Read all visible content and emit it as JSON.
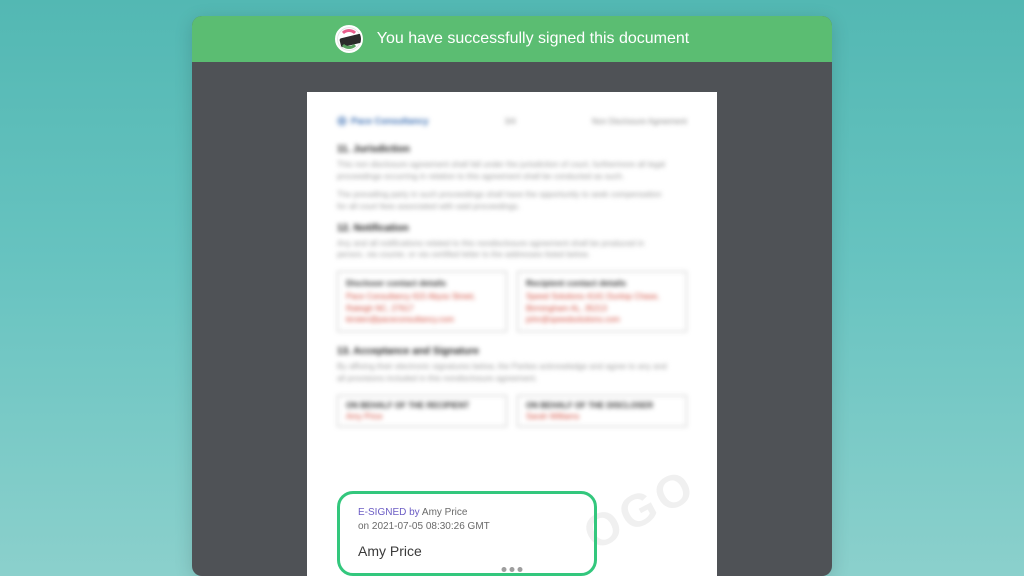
{
  "banner": {
    "message": "You have successfully signed this document"
  },
  "document": {
    "logo_label": "Pace Consultancy",
    "header_center": "3/4",
    "header_right": "Non Disclosure Agreement",
    "sections": {
      "jurisdiction": {
        "title": "11. Jurisdiction",
        "p1": "This non disclosure agreement shall fall under the jurisdiction of court, furthermore all legal proceedings occurring in relation to this agreement shall be conducted as such.",
        "p2": "The prevailing party in such proceedings shall have the opportunity to seek compensation for all court fees associated with said proceedings."
      },
      "notification": {
        "title": "12. Notification",
        "p1": "Any and all notifications related to this nondisclosure agreement shall be produced in person, via courier, or via certified letter to the addresses listed below."
      },
      "contacts": {
        "discloser": {
          "heading": "Discloser contact details",
          "body": "Pace Consultancy\n615 Abyss Street, Raleigh NC, 27617\nkirsten@paceconsultancy.com"
        },
        "recipient": {
          "heading": "Recipient contact details",
          "body": "Speed Solutions\n4141 Dunlop Chase, Birmingham AL, 35213\njohn@speedsolutions.com"
        }
      },
      "acceptance": {
        "title": "13. Acceptance and Signature",
        "p1": "By affixing their electronic signatures below, the Parties acknowledge and agree to any and all provisions included in this nondisclosure agreement."
      },
      "behalf": {
        "recipient": {
          "label": "ON BEHALF OF THE RECIPIENT",
          "name": "Amy Price"
        },
        "discloser": {
          "label": "ON BEHALF OF THE DISCLOSER",
          "name": "Sarah Williams"
        }
      }
    },
    "signature": {
      "line1_prefix": "E-SIGNED by ",
      "signer": "Amy Price",
      "line2_prefix": "on ",
      "timestamp": "2021-07-05 08:30:26 GMT",
      "display_name": "Amy Price"
    }
  }
}
